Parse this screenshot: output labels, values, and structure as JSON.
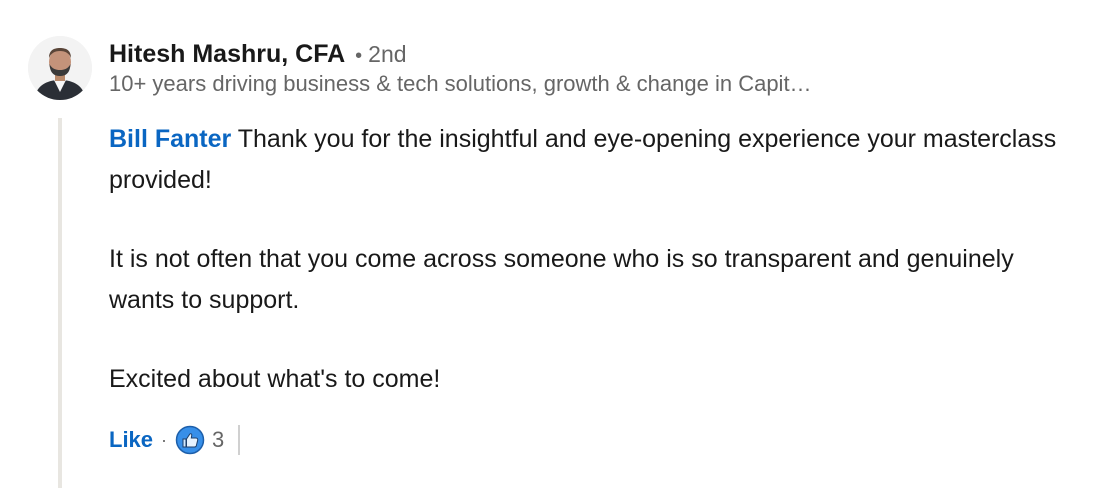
{
  "comment": {
    "author": {
      "name": "Hitesh Mashru, CFA",
      "separator": "•",
      "degree": "2nd",
      "headline": "10+ years driving business & tech solutions, growth & change in Capit…"
    },
    "mention": "Bill Fanter",
    "paragraphs": [
      " Thank you for the insightful and eye-opening experience your masterclass provided!",
      "It is not often that you come across someone who is so transparent and genuinely wants to support.",
      "Excited about what's to come!"
    ],
    "actions": {
      "like_label": "Like",
      "separator": "·",
      "reaction_icon": "thumbs-up-icon",
      "reaction_count": "3"
    }
  },
  "colors": {
    "link_blue": "#0a66c2",
    "text_primary": "#191919",
    "text_secondary": "#666666",
    "thread_line": "#e8e6e1"
  }
}
